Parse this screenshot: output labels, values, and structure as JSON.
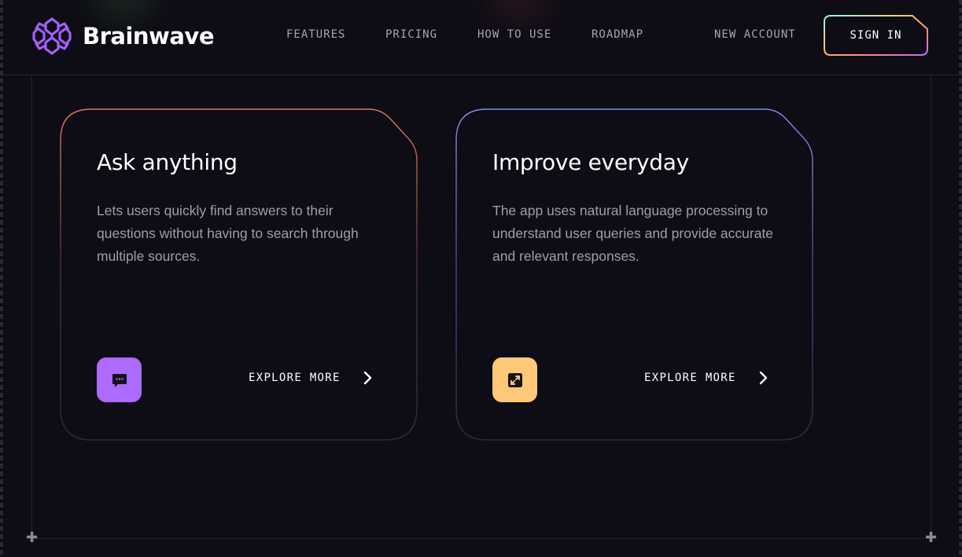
{
  "brand": {
    "name": "Brainwave",
    "logo_color": "#a25ff6"
  },
  "nav": {
    "items": [
      {
        "label": "FEATURES"
      },
      {
        "label": "PRICING"
      },
      {
        "label": "HOW TO USE"
      },
      {
        "label": "ROADMAP"
      }
    ],
    "new_account": "NEW ACCOUNT",
    "sign_in": "SIGN IN"
  },
  "cards": [
    {
      "title": "Ask anything",
      "description": "Lets users quickly find answers to their questions without having to search through multiple sources.",
      "icon": "chat-bubble-icon",
      "icon_bg": "#ac6aff",
      "border_accent": "#d77a5e",
      "explore_label": "EXPLORE MORE"
    },
    {
      "title": "Improve everyday",
      "description": "The app uses natural language processing to understand user queries and provide accurate and relevant responses.",
      "icon": "expand-arrows-icon",
      "icon_bg": "#ffc876",
      "border_accent": "#7a8de8",
      "explore_label": "EXPLORE MORE"
    }
  ]
}
